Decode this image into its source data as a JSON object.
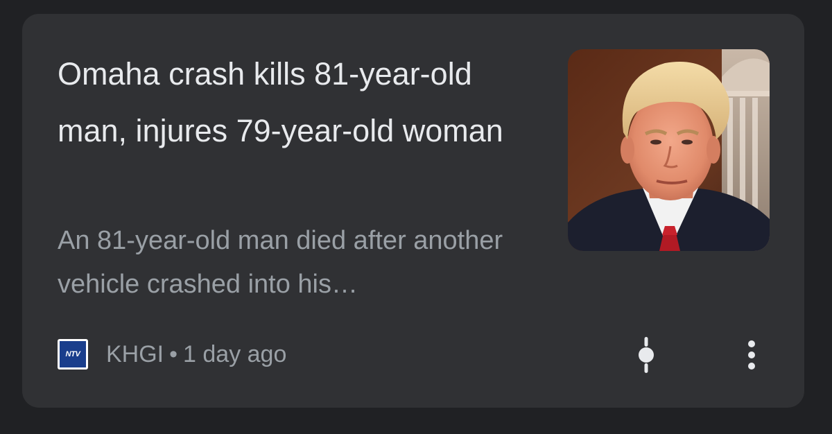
{
  "article": {
    "headline": "Omaha crash kills 81-year-old man, injures 79-year-old woman",
    "snippet": "An 81-year-old man died after another vehicle crashed into his…",
    "source": {
      "favicon_text": "NTV",
      "name": "KHGI",
      "separator": "•",
      "time": "1 day ago"
    },
    "thumbnail": {
      "description_icon": "portrait-image"
    }
  },
  "actions": {
    "full_coverage_icon": "full-coverage-icon",
    "more_icon": "more-vertical-icon"
  },
  "colors": {
    "background": "#202124",
    "card": "#303134",
    "headline": "#e8eaed",
    "secondary_text": "#9aa0a6"
  }
}
